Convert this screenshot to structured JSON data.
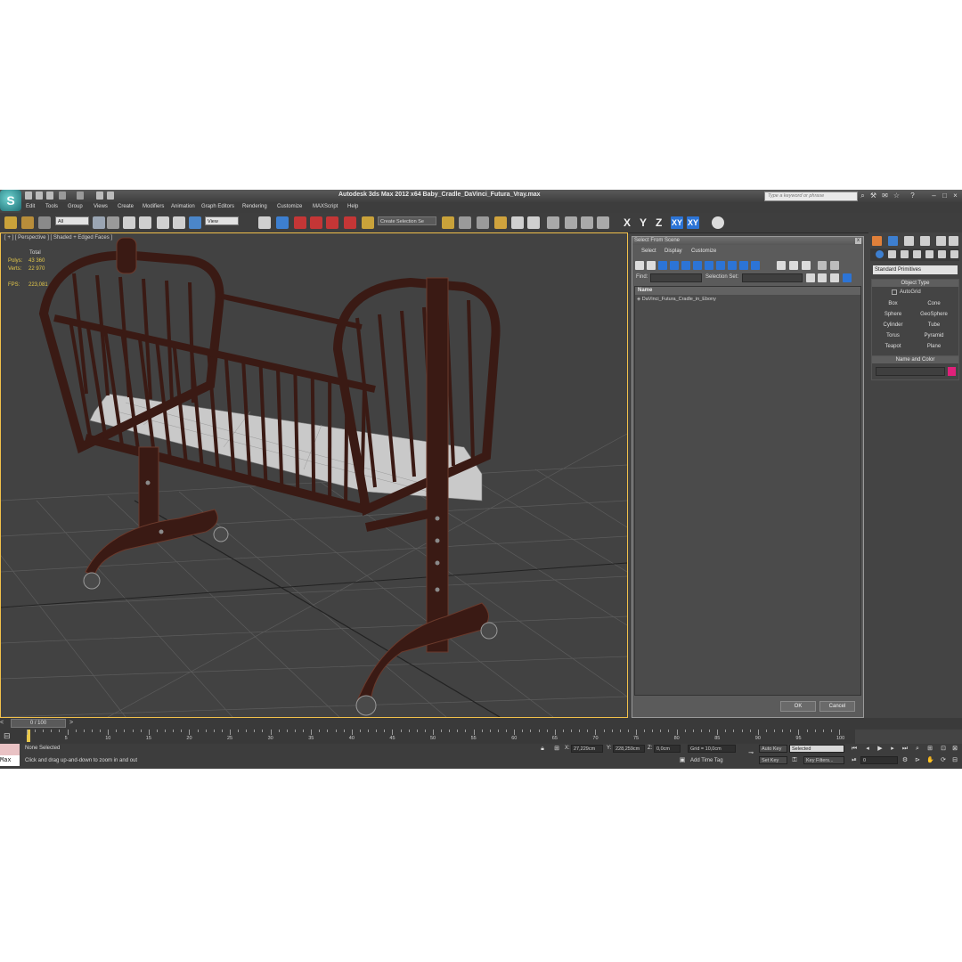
{
  "app": {
    "title": "Autodesk 3ds Max  2012 x64      Baby_Cradle_DaVinci_Futura_Vray.max",
    "search_placeholder": "Type a keyword or phrase",
    "logo_glyph": "S"
  },
  "menu": [
    "Edit",
    "Tools",
    "Group",
    "Views",
    "Create",
    "Modifiers",
    "Animation",
    "Graph Editors",
    "Rendering",
    "Customize",
    "MAXScript",
    "Help"
  ],
  "toolbar": {
    "filter_value": "All",
    "ref_coord_value": "View",
    "selection_set_placeholder": "Create Selection Se",
    "axes": [
      "X",
      "Y",
      "Z",
      "XY",
      "XY"
    ]
  },
  "viewport": {
    "label": "[ + ] [ Perspective ] [ Shaded + Edged Faces ]",
    "stats": {
      "total_label": "Total",
      "polys_label": "Polys:",
      "polys_value": "43 360",
      "verts_label": "Verts:",
      "verts_value": "22 970",
      "fps_label": "FPS:",
      "fps_value": "223,081"
    },
    "colors": {
      "wood": "#3a1a14",
      "wood_edge": "#6b3a2c",
      "mattress": "#cfcfcf",
      "grid": "#5a5a5a",
      "border": "#f1c04a"
    }
  },
  "dialog": {
    "title": "Select From Scene",
    "close": "x",
    "menu": [
      "Select",
      "Display",
      "Customize"
    ],
    "find_label": "Find:",
    "selection_set_label": "Selection Set:",
    "list_header": "Name",
    "items": [
      "DaVinci_Futura_Cradle_in_Ebony"
    ],
    "ok_label": "OK",
    "cancel_label": "Cancel"
  },
  "command_panel": {
    "category": "Standard Primitives",
    "object_type_header": "Object Type",
    "autogrid_label": "AutoGrid",
    "primitives": [
      "Box",
      "Cone",
      "Sphere",
      "GeoSphere",
      "Cylinder",
      "Tube",
      "Torus",
      "Pyramid",
      "Teapot",
      "Plane"
    ],
    "name_color_header": "Name and Color",
    "color": "#e0207a"
  },
  "timeline": {
    "frame_label": "0 / 100",
    "ticks": [
      "5",
      "10",
      "15",
      "20",
      "25",
      "30",
      "35",
      "40",
      "45",
      "50",
      "55",
      "60",
      "65",
      "70",
      "75",
      "80",
      "85",
      "90",
      "95",
      "100"
    ]
  },
  "status": {
    "maxscript_label": "Max",
    "selection_status": "None Selected",
    "prompt": "Click and drag up-and-down to zoom in and out",
    "x_label": "X:",
    "x_value": "27,229cm",
    "y_label": "Y:",
    "y_value": "228,259cm",
    "z_label": "Z:",
    "z_value": "0,0cm",
    "grid": "Grid = 10,0cm",
    "add_time_tag": "Add Time Tag",
    "auto_key": "Auto Key",
    "set_key": "Set Key",
    "selected_value": "Selected",
    "key_filters": "Key Filters...",
    "frame_value": "0"
  }
}
